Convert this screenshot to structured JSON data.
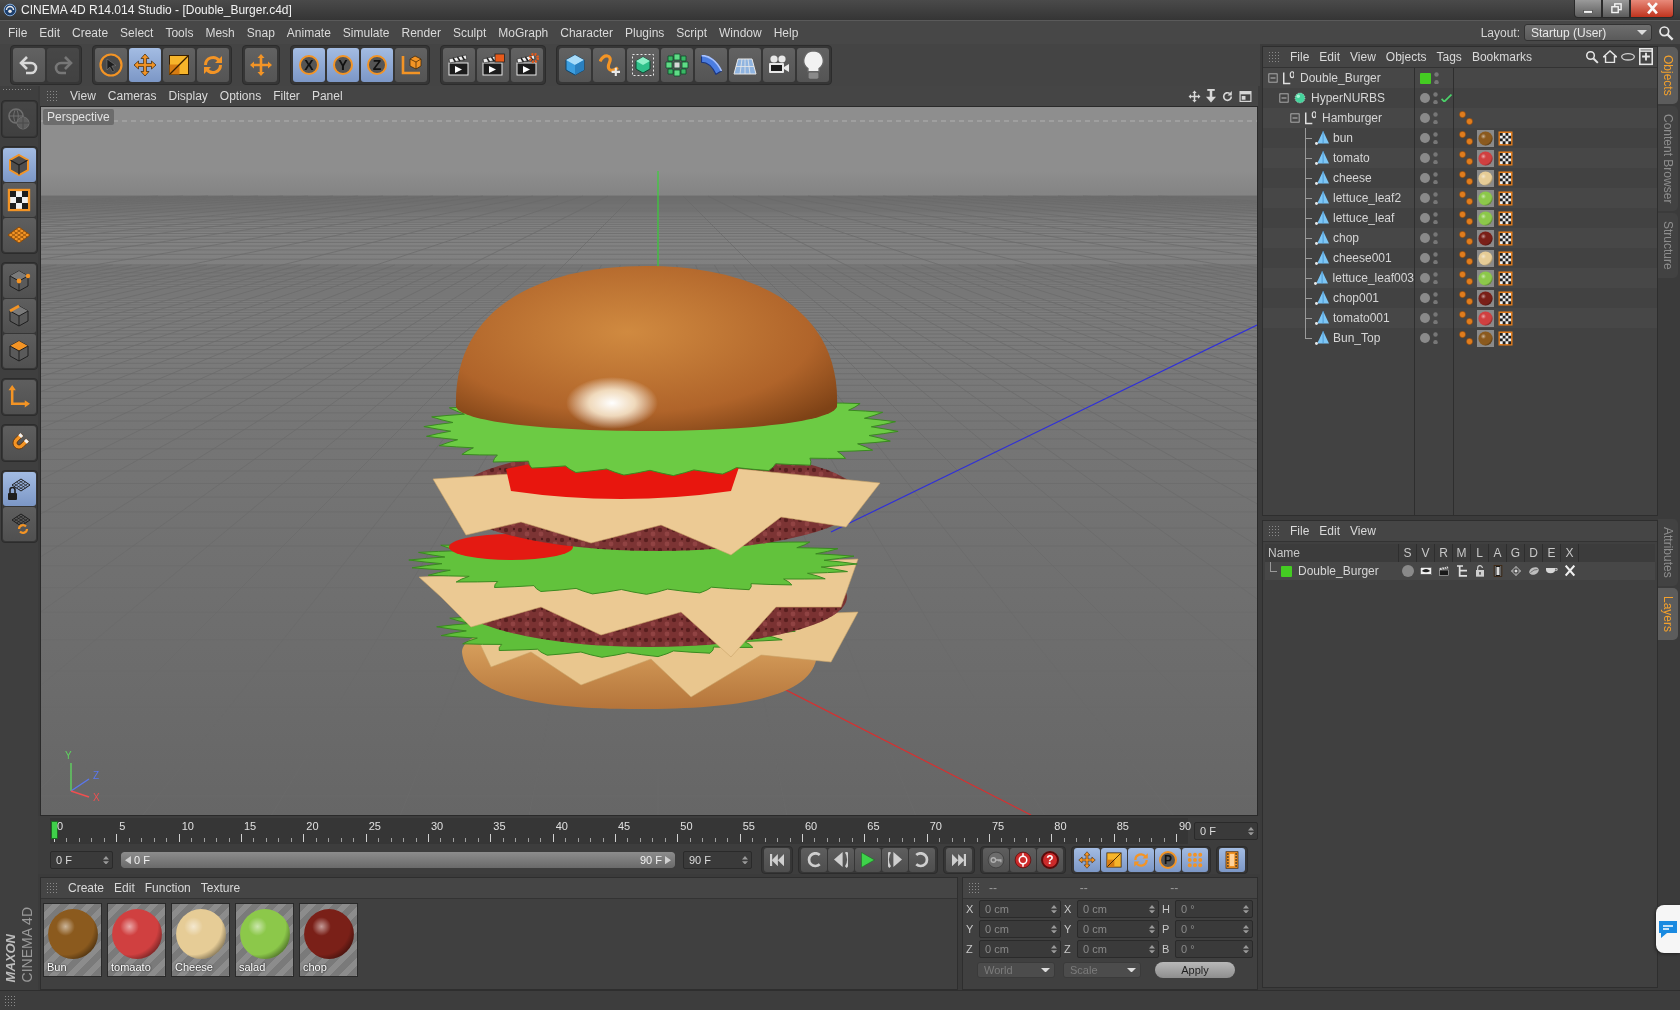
{
  "window": {
    "title": "CINEMA 4D R14.014 Studio - [Double_Burger.c4d]"
  },
  "menu_bar": [
    "File",
    "Edit",
    "Create",
    "Select",
    "Tools",
    "Mesh",
    "Snap",
    "Animate",
    "Simulate",
    "Render",
    "Sculpt",
    "MoGraph",
    "Character",
    "Plugins",
    "Script",
    "Window",
    "Help"
  ],
  "layout": {
    "label": "Layout:",
    "value": "Startup (User)"
  },
  "toolbar": [
    [
      {
        "kind": "undo",
        "disabled": false
      },
      {
        "kind": "redo",
        "disabled": true
      }
    ],
    [
      {
        "kind": "live_select",
        "selected": false
      },
      {
        "kind": "move",
        "selected": true
      },
      {
        "kind": "scale",
        "selected": false
      },
      {
        "kind": "rotate",
        "selected": false
      }
    ],
    [
      {
        "kind": "last_tool",
        "selected": false
      }
    ],
    [
      {
        "kind": "axis",
        "label": "X",
        "selected": true
      },
      {
        "kind": "axis",
        "label": "Y",
        "selected": true
      },
      {
        "kind": "axis",
        "label": "Z",
        "selected": true
      },
      {
        "kind": "coordinate_system",
        "selected": false
      }
    ],
    [
      {
        "kind": "render_view"
      },
      {
        "kind": "render_picture"
      },
      {
        "kind": "render_settings"
      }
    ],
    [
      {
        "kind": "cube"
      },
      {
        "kind": "pen"
      },
      {
        "kind": "subdivision"
      },
      {
        "kind": "cloner"
      },
      {
        "kind": "deformer"
      },
      {
        "kind": "floor"
      },
      {
        "kind": "camera"
      },
      {
        "kind": "light"
      }
    ]
  ],
  "left_toolbar": [
    [
      {
        "kind": "make_editable",
        "disabled": true
      }
    ],
    [
      {
        "kind": "model",
        "selected": true
      },
      {
        "kind": "texture",
        "selected": false
      },
      {
        "kind": "workplane",
        "selected": false
      }
    ],
    [
      {
        "kind": "points",
        "selected": false
      },
      {
        "kind": "edges",
        "selected": false
      },
      {
        "kind": "polygons",
        "selected": false
      }
    ],
    [
      {
        "kind": "axis_mode",
        "selected": false
      }
    ],
    [
      {
        "kind": "snap",
        "selected": false
      }
    ],
    [
      {
        "kind": "locked_workplane",
        "selected": true
      },
      {
        "kind": "planar_workplane",
        "selected": false
      }
    ]
  ],
  "viewport": {
    "menu": [
      "View",
      "Cameras",
      "Display",
      "Options",
      "Filter",
      "Panel"
    ],
    "camera": "Perspective",
    "axis_labels": [
      "Y",
      "Z",
      "X"
    ]
  },
  "timeline": {
    "ticks": [
      "0",
      "5",
      "10",
      "15",
      "20",
      "25",
      "30",
      "35",
      "40",
      "45",
      "50",
      "55",
      "60",
      "65",
      "70",
      "75",
      "80",
      "85",
      "90"
    ],
    "level": 0,
    "frame": "0 F"
  },
  "playback": {
    "start": "0 F",
    "range": {
      "start": "0 F",
      "end": "90 F",
      "level": 1
    },
    "end": "90 F"
  },
  "transport": [
    [
      {
        "kind": "go_start"
      }
    ],
    [
      {
        "kind": "prev_key"
      },
      {
        "kind": "step_back"
      },
      {
        "kind": "play"
      },
      {
        "kind": "step_forward"
      },
      {
        "kind": "next_key"
      }
    ],
    [
      {
        "kind": "go_end"
      }
    ],
    [
      {
        "kind": "key"
      },
      {
        "kind": "autokey"
      },
      {
        "kind": "keyframe_selection",
        "label": "?"
      }
    ],
    [
      {
        "kind": "key_position",
        "selected": true
      },
      {
        "kind": "key_scale",
        "selected": true
      },
      {
        "kind": "key_rotation",
        "selected": true
      },
      {
        "kind": "key_parameter",
        "label": "P",
        "selected": true
      },
      {
        "kind": "key_pla",
        "selected": true
      }
    ],
    [
      {
        "kind": "film",
        "selected": true
      }
    ]
  ],
  "materials": {
    "menu": [
      "Create",
      "Edit",
      "Function",
      "Texture"
    ],
    "items": [
      {
        "name": "Bun",
        "color": "#8b5a1e"
      },
      {
        "name": "tomaato",
        "color": "#d04040"
      },
      {
        "name": "Cheese",
        "color": "#e6cc96"
      },
      {
        "name": "salad",
        "color": "#8cc84a"
      },
      {
        "name": "chop",
        "color": "#7a2018"
      }
    ]
  },
  "coordinates": {
    "headers": [
      "--",
      "--",
      "--"
    ],
    "rows": [
      {
        "axes": [
          "X",
          "X",
          "H"
        ],
        "values": [
          "0 cm",
          "0 cm",
          "0 °"
        ]
      },
      {
        "axes": [
          "Y",
          "Y",
          "P"
        ],
        "values": [
          "0 cm",
          "0 cm",
          "0 °"
        ]
      },
      {
        "axes": [
          "Z",
          "Z",
          "B"
        ],
        "values": [
          "0 cm",
          "0 cm",
          "0 °"
        ]
      }
    ],
    "mode": "World",
    "transform": "Scale",
    "apply": "Apply",
    "disabled": true
  },
  "object_manager": {
    "menu": [
      "File",
      "Edit",
      "View",
      "Objects",
      "Tags",
      "Bookmarks"
    ],
    "objects": [
      {
        "name": "Double_Burger",
        "kind": "null",
        "expanded": true,
        "color": "#44cc22",
        "children": [
          {
            "name": "HyperNURBS",
            "kind": "generator",
            "expanded": true,
            "enabled": true,
            "children": [
              {
                "name": "Hamburger",
                "kind": "null",
                "expanded": true,
                "tags": [
                  {
                    "kind": "phong"
                  }
                ],
                "children": [
                  {
                    "name": "bun",
                    "kind": "polygon",
                    "tags": [
                      {
                        "kind": "phong"
                      },
                      {
                        "kind": "material",
                        "color": "#8b5a1e"
                      },
                      {
                        "kind": "uvw"
                      }
                    ]
                  },
                  {
                    "name": "tomato",
                    "kind": "polygon",
                    "tags": [
                      {
                        "kind": "phong"
                      },
                      {
                        "kind": "material",
                        "color": "#d04040"
                      },
                      {
                        "kind": "uvw"
                      }
                    ]
                  },
                  {
                    "name": "cheese",
                    "kind": "polygon",
                    "tags": [
                      {
                        "kind": "phong"
                      },
                      {
                        "kind": "material",
                        "color": "#e6cc96"
                      },
                      {
                        "kind": "uvw"
                      }
                    ]
                  },
                  {
                    "name": "lettuce_leaf2",
                    "kind": "polygon",
                    "tags": [
                      {
                        "kind": "phong"
                      },
                      {
                        "kind": "material",
                        "color": "#8cc84a"
                      },
                      {
                        "kind": "uvw"
                      }
                    ]
                  },
                  {
                    "name": "lettuce_leaf",
                    "kind": "polygon",
                    "tags": [
                      {
                        "kind": "phong"
                      },
                      {
                        "kind": "material",
                        "color": "#8cc84a"
                      },
                      {
                        "kind": "uvw"
                      }
                    ]
                  },
                  {
                    "name": "chop",
                    "kind": "polygon",
                    "tags": [
                      {
                        "kind": "phong"
                      },
                      {
                        "kind": "material",
                        "color": "#7a2018"
                      },
                      {
                        "kind": "uvw"
                      }
                    ]
                  },
                  {
                    "name": "cheese001",
                    "kind": "polygon",
                    "tags": [
                      {
                        "kind": "phong"
                      },
                      {
                        "kind": "material",
                        "color": "#e6cc96"
                      },
                      {
                        "kind": "uvw"
                      }
                    ]
                  },
                  {
                    "name": "lettuce_leaf003",
                    "kind": "polygon",
                    "tags": [
                      {
                        "kind": "phong"
                      },
                      {
                        "kind": "material",
                        "color": "#8cc84a"
                      },
                      {
                        "kind": "uvw"
                      }
                    ]
                  },
                  {
                    "name": "chop001",
                    "kind": "polygon",
                    "tags": [
                      {
                        "kind": "phong"
                      },
                      {
                        "kind": "material",
                        "color": "#7a2018"
                      },
                      {
                        "kind": "uvw"
                      }
                    ]
                  },
                  {
                    "name": "tomato001",
                    "kind": "polygon",
                    "tags": [
                      {
                        "kind": "phong"
                      },
                      {
                        "kind": "material",
                        "color": "#d04040"
                      },
                      {
                        "kind": "uvw"
                      }
                    ]
                  },
                  {
                    "name": "Bun_Top",
                    "kind": "polygon",
                    "tags": [
                      {
                        "kind": "phong"
                      },
                      {
                        "kind": "material",
                        "color": "#8b5a1e"
                      },
                      {
                        "kind": "uvw"
                      }
                    ]
                  }
                ]
              }
            ]
          }
        ]
      }
    ]
  },
  "layer_manager": {
    "menu": [
      "File",
      "Edit",
      "View"
    ],
    "columns": [
      "Name",
      "S",
      "V",
      "R",
      "M",
      "L",
      "A",
      "G",
      "D",
      "E",
      "X"
    ],
    "layers": [
      {
        "name": "Double_Burger",
        "color": "#44cc22"
      }
    ]
  },
  "side_tabs_top": [
    {
      "label": "Objects",
      "selected": true
    },
    {
      "label": "Content Browser",
      "selected": false
    },
    {
      "label": "Structure",
      "selected": false
    }
  ],
  "side_tabs_bottom": [
    {
      "label": "Attributes",
      "selected": false
    },
    {
      "label": "Layers",
      "selected": true
    }
  ],
  "logo": {
    "brand": "MAXON",
    "product": "CINEMA 4D"
  }
}
